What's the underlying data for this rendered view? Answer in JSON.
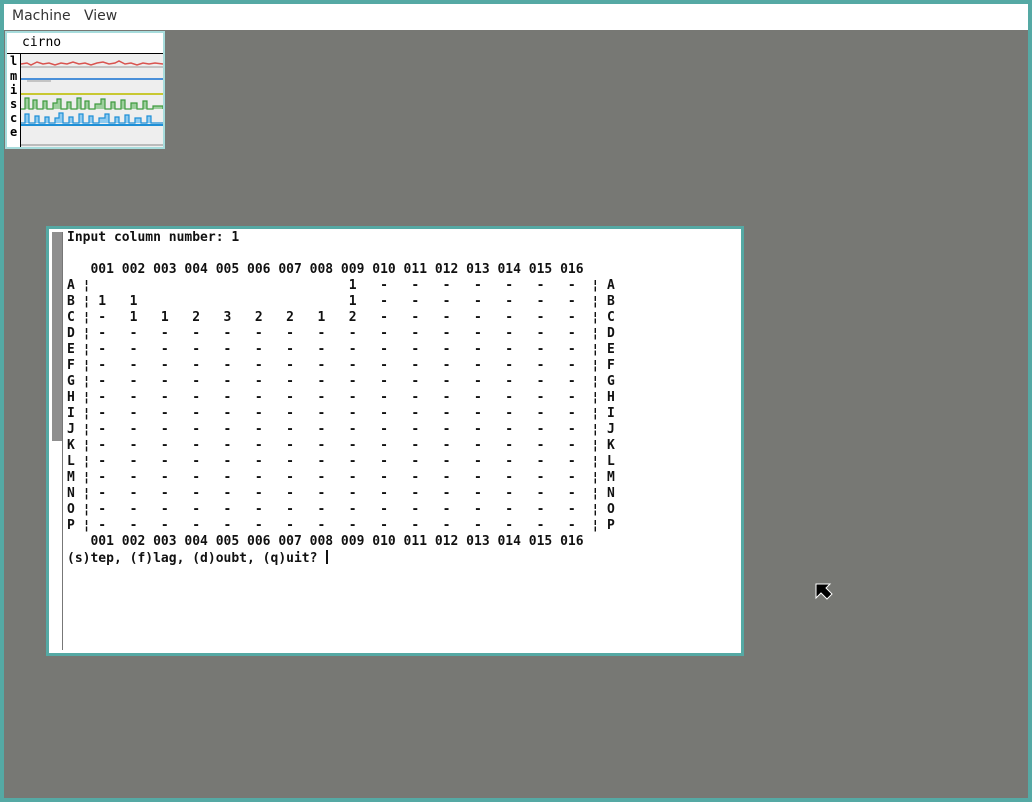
{
  "menubar": {
    "machine_label": "Machine",
    "view_label": "View"
  },
  "stats": {
    "host": "cirno",
    "rows": [
      "l",
      "m",
      "i",
      "s",
      "c",
      "e"
    ],
    "colors": {
      "load": "#d9534f",
      "mem": "#4a90d9",
      "intr": "#c8c832",
      "syscall": "#3f9a3f",
      "cpu": "#1e8fd6",
      "ether": "#888888"
    }
  },
  "terminal": {
    "lines": [
      "Input column number: 1",
      "",
      "   001 002 003 004 005 006 007 008 009 010 011 012 013 014 015 016",
      "A ¦                                 1   -   -   -   -   -   -   -  ¦ A",
      "B ¦ 1   1                           1   -   -   -   -   -   -   -  ¦ B",
      "C ¦ -   1   1   2   3   2   2   1   2   -   -   -   -   -   -   -  ¦ C",
      "D ¦ -   -   -   -   -   -   -   -   -   -   -   -   -   -   -   -  ¦ D",
      "E ¦ -   -   -   -   -   -   -   -   -   -   -   -   -   -   -   -  ¦ E",
      "F ¦ -   -   -   -   -   -   -   -   -   -   -   -   -   -   -   -  ¦ F",
      "G ¦ -   -   -   -   -   -   -   -   -   -   -   -   -   -   -   -  ¦ G",
      "H ¦ -   -   -   -   -   -   -   -   -   -   -   -   -   -   -   -  ¦ H",
      "I ¦ -   -   -   -   -   -   -   -   -   -   -   -   -   -   -   -  ¦ I",
      "J ¦ -   -   -   -   -   -   -   -   -   -   -   -   -   -   -   -  ¦ J",
      "K ¦ -   -   -   -   -   -   -   -   -   -   -   -   -   -   -   -  ¦ K",
      "L ¦ -   -   -   -   -   -   -   -   -   -   -   -   -   -   -   -  ¦ L",
      "M ¦ -   -   -   -   -   -   -   -   -   -   -   -   -   -   -   -  ¦ M",
      "N ¦ -   -   -   -   -   -   -   -   -   -   -   -   -   -   -   -  ¦ N",
      "O ¦ -   -   -   -   -   -   -   -   -   -   -   -   -   -   -   -  ¦ O",
      "P ¦ -   -   -   -   -   -   -   -   -   -   -   -   -   -   -   -  ¦ P",
      "   001 002 003 004 005 006 007 008 009 010 011 012 013 014 015 016"
    ],
    "prompt": "(s)tep, (f)lag, (d)oubt, (q)uit? "
  },
  "icons": {
    "mouse": "arrow-cursor-icon"
  }
}
